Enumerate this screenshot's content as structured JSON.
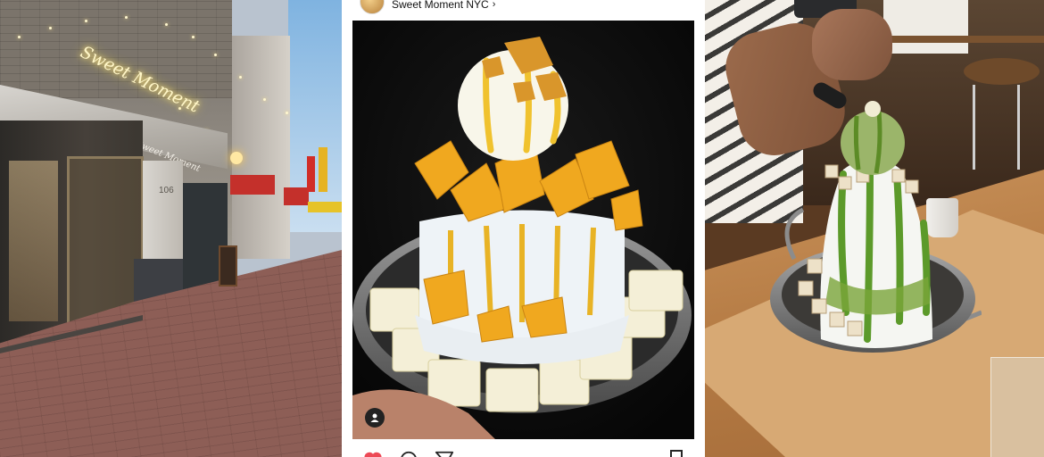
{
  "panels": {
    "street": {
      "neon_sign": "Sweet Moment",
      "awning_sign": "Sweet Moment",
      "address_number": "106"
    },
    "instagram_post": {
      "username": "Sweet Moment NYC",
      "chevron": "›"
    },
    "matcha": {}
  },
  "colors": {
    "instagram_like": "#ed4956",
    "instagram_icon": "#262626"
  },
  "icons": [
    "user-tag-icon",
    "heart-icon",
    "comment-icon",
    "share-icon",
    "bookmark-icon"
  ]
}
